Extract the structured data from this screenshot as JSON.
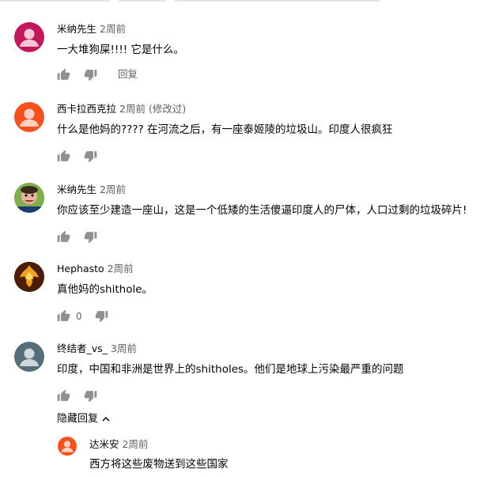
{
  "comments": [
    {
      "author": "米纳先生",
      "time": "2周前",
      "edited": "",
      "text": "一大堆狗屎!!!! 它是什么。",
      "avatar_color": "#c2185b",
      "show_reply": true,
      "reply_label": "回复",
      "likes": ""
    },
    {
      "author": "西卡拉西克拉",
      "time": "2周前",
      "edited": "(修改过)",
      "text": "什么是他妈的???? 在河流之后，有一座泰姬陵的垃圾山。印度人很疯狂",
      "avatar_color": "#f4511e",
      "show_reply": false,
      "reply_label": "",
      "likes": ""
    },
    {
      "author": "米纳先生",
      "time": "2周前",
      "edited": "",
      "text": "你应该至少建造一座山，这是一个低矮的生活傻逼印度人的尸体，人口过剩的垃圾碎片!",
      "avatar_color": "#8bc34a",
      "show_reply": false,
      "reply_label": "",
      "likes": ""
    },
    {
      "author": "Hephasto",
      "time": "2周前",
      "edited": "",
      "text": "真他妈的shithole。",
      "avatar_color": "#7a3b10",
      "show_reply": false,
      "reply_label": "",
      "likes": "0"
    },
    {
      "author": "终结者_vs_",
      "time": "3周前",
      "edited": "",
      "text": "印度，中国和非洲是世界上的shitholes。他们是地球上污染最严重的问题",
      "avatar_color": "#546e7a",
      "show_reply": false,
      "reply_label": "",
      "likes": ""
    }
  ],
  "hide_replies_label": "隐藏回复",
  "reply": {
    "author": "达米安",
    "time": "2周前",
    "text": "西方将这些废物送到这些国家",
    "avatar_color": "#f4511e"
  },
  "icons": {
    "like": "thumb-up-icon",
    "dislike": "thumb-down-icon",
    "hide": "chevron-up-icon",
    "avatar": "person-silhouette-icon"
  }
}
